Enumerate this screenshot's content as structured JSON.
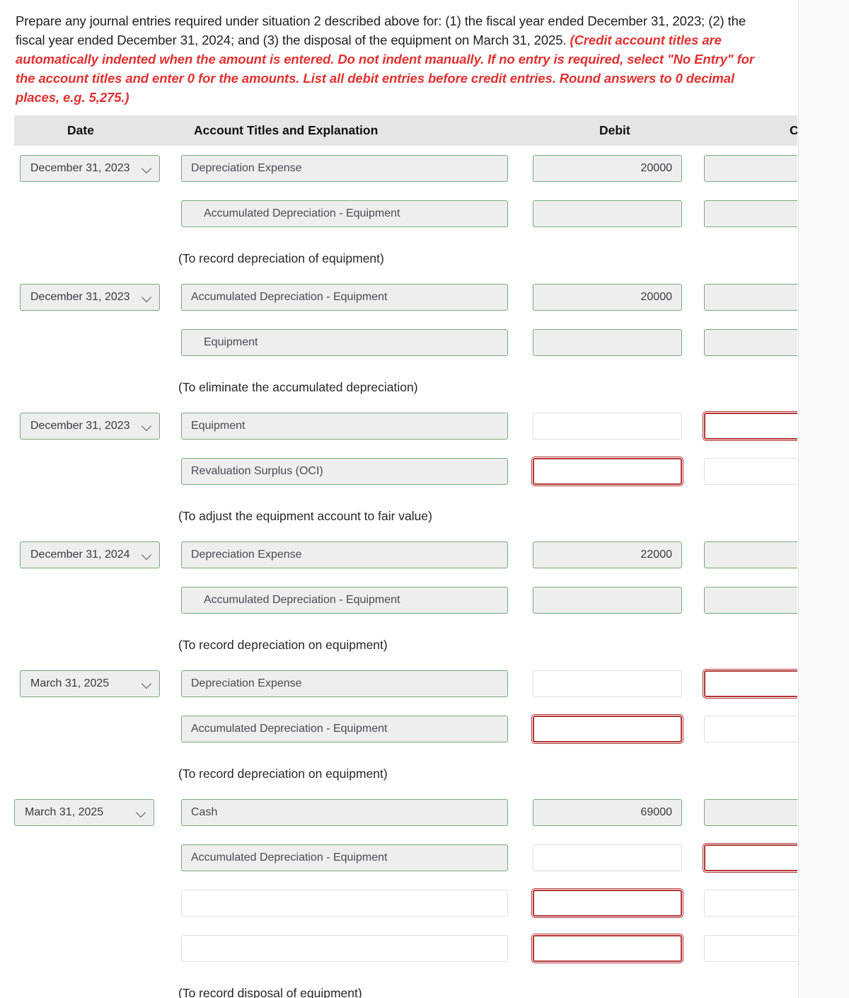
{
  "instructions": {
    "black_text": "Prepare any journal entries required under situation 2 described above for: (1) the fiscal year ended December 31, 2023; (2) the fiscal year ended December 31, 2024; and (3) the disposal of the equipment on March 31, 2025. ",
    "red_text": "(Credit account titles are automatically indented when the amount is entered. Do not indent manually. If no entry is required, select \"No Entry\" for the account titles and enter 0 for the amounts. List all debit entries before credit entries. Round answers to 0 decimal places, e.g. 5,275.)"
  },
  "table": {
    "headers": {
      "date": "Date",
      "account": "Account Titles and Explanation",
      "debit": "Debit",
      "credit": "Cr"
    },
    "select_caret_icon": "chevron-down-icon",
    "rows": [
      {
        "date": "December 31, 2023",
        "date_state": "filled",
        "account": "Depreciation Expense",
        "account_state": "filled",
        "account_indent": false,
        "debit": "20000",
        "debit_state": "filled",
        "credit": "",
        "credit_state": "filled"
      },
      {
        "date": "",
        "date_state": "none",
        "account": "Accumulated Depreciation - Equipment",
        "account_state": "filled",
        "account_indent": true,
        "debit": "",
        "debit_state": "filled",
        "credit": "",
        "credit_state": "filled"
      },
      {
        "memo": "(To record depreciation of equipment)"
      },
      {
        "date": "December 31, 2023",
        "date_state": "filled",
        "account": "Accumulated Depreciation - Equipment",
        "account_state": "filled",
        "account_indent": false,
        "debit": "20000",
        "debit_state": "filled",
        "credit": "",
        "credit_state": "filled"
      },
      {
        "date": "",
        "date_state": "none",
        "account": "Equipment",
        "account_state": "filled",
        "account_indent": true,
        "debit": "",
        "debit_state": "filled",
        "credit": "",
        "credit_state": "filled"
      },
      {
        "memo": "(To eliminate the accumulated depreciation)"
      },
      {
        "date": "December 31, 2023",
        "date_state": "filled",
        "account": "Equipment",
        "account_state": "filled",
        "account_indent": false,
        "debit": "",
        "debit_state": "empty",
        "credit": "",
        "credit_state": "error"
      },
      {
        "date": "",
        "date_state": "none",
        "account": "Revaluation Surplus (OCI)",
        "account_state": "filled",
        "account_indent": false,
        "debit": "",
        "debit_state": "error",
        "credit": "",
        "credit_state": "empty"
      },
      {
        "memo": "(To adjust the equipment account to fair value)"
      },
      {
        "date": "December 31, 2024",
        "date_state": "filled",
        "account": "Depreciation Expense",
        "account_state": "filled",
        "account_indent": false,
        "debit": "22000",
        "debit_state": "filled",
        "credit": "",
        "credit_state": "filled"
      },
      {
        "date": "",
        "date_state": "none",
        "account": "Accumulated Depreciation - Equipment",
        "account_state": "filled",
        "account_indent": true,
        "debit": "",
        "debit_state": "filled",
        "credit": "",
        "credit_state": "filled"
      },
      {
        "memo": "(To record depreciation on equipment)"
      },
      {
        "date": "March 31, 2025",
        "date_state": "filled",
        "account": "Depreciation Expense",
        "account_state": "filled",
        "account_indent": false,
        "debit": "",
        "debit_state": "empty",
        "credit": "",
        "credit_state": "error"
      },
      {
        "date": "",
        "date_state": "none",
        "account": "Accumulated Depreciation - Equipment",
        "account_state": "filled",
        "account_indent": false,
        "debit": "",
        "debit_state": "error",
        "credit": "",
        "credit_state": "empty"
      },
      {
        "memo": "(To record depreciation on equipment)"
      },
      {
        "date": "March 31, 2025",
        "date_state": "filled",
        "date_wide": true,
        "account": "Cash",
        "account_state": "filled",
        "account_indent": false,
        "debit": "69000",
        "debit_state": "filled",
        "credit": "",
        "credit_state": "filled"
      },
      {
        "date": "",
        "date_state": "none",
        "account": "Accumulated Depreciation - Equipment",
        "account_state": "filled",
        "account_indent": false,
        "debit": "",
        "debit_state": "empty",
        "credit": "",
        "credit_state": "error"
      },
      {
        "date": "",
        "date_state": "none",
        "account": "",
        "account_state": "empty",
        "account_indent": false,
        "debit": "",
        "debit_state": "error",
        "credit": "",
        "credit_state": "empty"
      },
      {
        "date": "",
        "date_state": "none",
        "account": "",
        "account_state": "empty",
        "account_indent": false,
        "debit": "",
        "debit_state": "error",
        "credit": "",
        "credit_state": "empty"
      },
      {
        "memo": "(To record disposal of equipment)"
      }
    ]
  },
  "colors": {
    "filled_border": "#7aa87e",
    "filled_background": "#eeeeee",
    "error_border": "#b23535",
    "empty_border": "#e0e0e0",
    "header_background": "#e5e5e5",
    "instruction_red": "#e03131"
  }
}
